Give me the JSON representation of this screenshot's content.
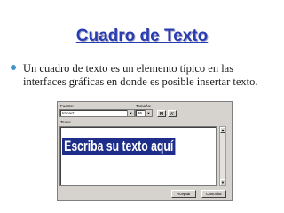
{
  "slide": {
    "title": "Cuadro de Texto",
    "bullet_text": "Un cuadro de texto es un elemento típico en las interfaces gráficas en donde es posible insertar texto."
  },
  "dialog": {
    "font_label": "Fuente:",
    "font_value": "Impact",
    "size_label": "Tamaño:",
    "size_value": "36",
    "bold_label": "N",
    "italic_label": "K",
    "text_label": "Texto:",
    "text_value": "Escriba su texto aquí",
    "scroll_up_icon": "▲",
    "scroll_down_icon": "▼",
    "dropdown_icon": "▼",
    "ok_label": "Aceptar",
    "cancel_label": "Cancelar"
  },
  "colors": {
    "title": "#2a3db0",
    "bullet": "#3f93c8",
    "text_highlight": "#1e2d8a",
    "dialog_bg": "#d6d3ce"
  }
}
